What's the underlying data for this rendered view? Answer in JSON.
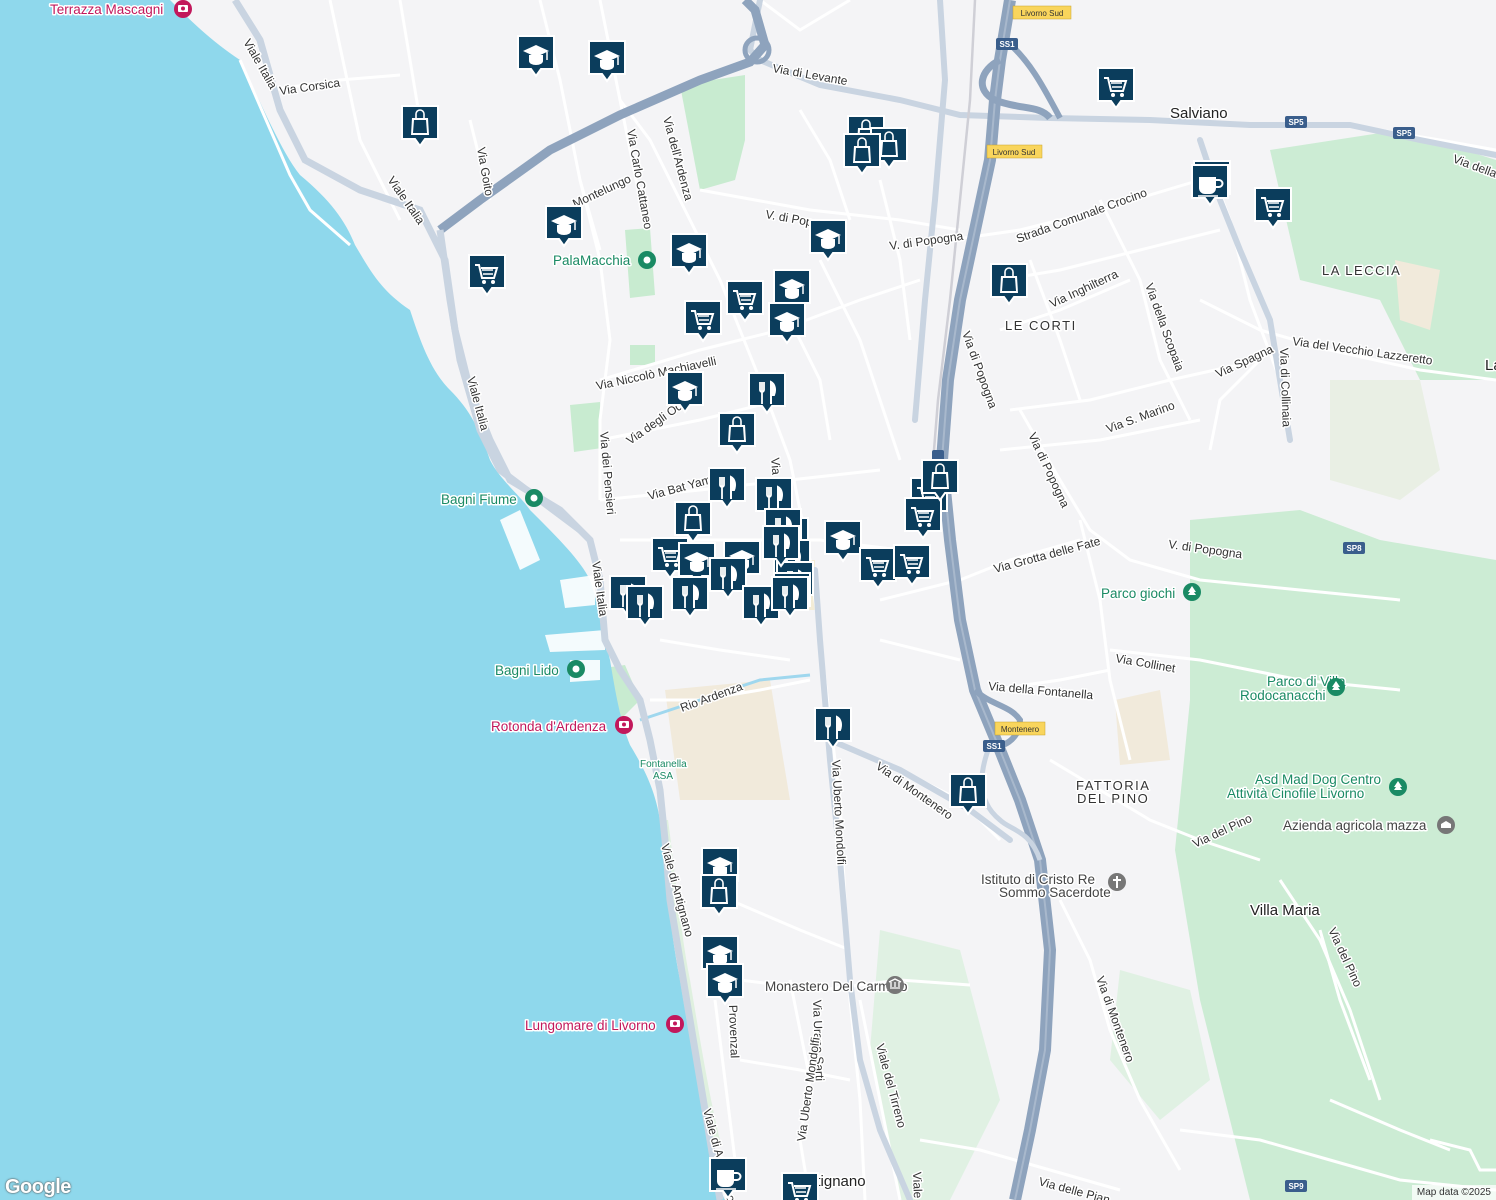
{
  "colors": {
    "sea": "#8fd8ec",
    "land": "#f4f4f6",
    "park": "#c8ebd0",
    "highway": "#8ea3bd",
    "road": "#ffffff",
    "marker": "#0b3d5c",
    "sand": "#f1eadb"
  },
  "street_labels": [
    {
      "text": "Viale Italia",
      "r": 60
    },
    {
      "text": "Via Corsica",
      "r": -8
    },
    {
      "text": "Via Goito",
      "r": 80
    },
    {
      "text": "Viale Italia",
      "r": 55
    },
    {
      "text": "Via di Levante",
      "r": 10
    },
    {
      "text": "Via Carlo Cattaneo",
      "r": 80
    },
    {
      "text": "Via dell'Ardenza",
      "r": 75
    },
    {
      "text": "Montelungo",
      "r": -25
    },
    {
      "text": "V. di Popogna",
      "r": 10
    },
    {
      "text": "V. di Popogna",
      "r": -8
    },
    {
      "text": "Strada Comunale Crocino",
      "r": -20
    },
    {
      "text": "Via Inghilterra",
      "r": -25
    },
    {
      "text": "Via della Scopaia",
      "r": 70
    },
    {
      "text": "Via Spagna",
      "r": -25
    },
    {
      "text": "Via del Vecchio Lazzeretto",
      "r": 8
    },
    {
      "text": "Via di Collinaia",
      "r": 88
    },
    {
      "text": "Via S. Marino",
      "r": -20
    },
    {
      "text": "Via di Popogna",
      "r": 70
    },
    {
      "text": "Via di Popogna",
      "r": 65
    },
    {
      "text": "V. di Popogna",
      "r": 8
    },
    {
      "text": "Via Niccolò Machiavelli",
      "r": -12
    },
    {
      "text": "Via degli Od",
      "r": -35
    },
    {
      "text": "Via dei Pensieri",
      "r": 85
    },
    {
      "text": "Via Bat Yam",
      "r": -15
    },
    {
      "text": "Viale Italia",
      "r": 75
    },
    {
      "text": "Viale Italia",
      "r": 82
    },
    {
      "text": "Rio Ardenza",
      "r": -20
    },
    {
      "text": "Via Grotta delle Fate",
      "r": -15
    },
    {
      "text": "Via Collinet",
      "r": 10
    },
    {
      "text": "Via della Fontanella",
      "r": 5
    },
    {
      "text": "Via di Montenero",
      "r": 35
    },
    {
      "text": "Via Uberto Mondolfi",
      "r": 87
    },
    {
      "text": "Via del Pino",
      "r": -25
    },
    {
      "text": "Viale di Antignano",
      "r": 75
    },
    {
      "text": "Provenzal",
      "r": 88
    },
    {
      "text": "Via Urano Sarti",
      "r": 88
    },
    {
      "text": "Via Uberto Mondolfi",
      "r": -82
    },
    {
      "text": "Viale del Tirreno",
      "r": 75
    },
    {
      "text": "Via di Montenero",
      "r": 70
    },
    {
      "text": "Via del Pino",
      "r": 65
    },
    {
      "text": "Viale di Antignano",
      "r": 75
    },
    {
      "text": "Via delle Pian",
      "r": 15
    },
    {
      "text": "Via della",
      "r": 20
    },
    {
      "text": "Viale",
      "r": 88
    },
    {
      "text": "Via dell'Ardenza",
      "r": 85
    }
  ],
  "area_labels": [
    "Salviano",
    "LE CORTI",
    "LA LECCIA",
    "FATTORIA",
    "DEL PINO",
    "Villa Maria",
    "Antignano",
    "La"
  ],
  "pois": [
    {
      "name": "Terrazza Mascagni",
      "type": "camera"
    },
    {
      "name": "PalaMacchia",
      "type": "park"
    },
    {
      "name": "Bagni Fiume",
      "type": "park"
    },
    {
      "name": "Bagni Lido",
      "type": "park"
    },
    {
      "name": "Rotonda d'Ardenza",
      "type": "camera"
    },
    {
      "name": "Parco giochi",
      "type": "tree"
    },
    {
      "name": "Parco di Villa",
      "type": "tree"
    },
    {
      "name": "Rodocanacchi",
      "type": "tree"
    },
    {
      "name": "Asd Mad Dog Centro",
      "type": "tree"
    },
    {
      "name": "Attività Cinofile Livorno",
      "type": "tree"
    },
    {
      "name": "Azienda agricola mazza",
      "type": "museum"
    },
    {
      "name": "Istituto di Cristo Re",
      "type": "church"
    },
    {
      "name": "Sommo Sacerdote",
      "type": "church"
    },
    {
      "name": "Monastero Del Carmelo",
      "type": "museum"
    },
    {
      "name": "Lungomare di Livorno",
      "type": "camera"
    },
    {
      "name": "Fontanella",
      "type": "text"
    },
    {
      "name": "ASA",
      "type": "text"
    }
  ],
  "road_badges": [
    {
      "text": "Livorno Sud",
      "kind": "yellow"
    },
    {
      "text": "SS1",
      "kind": "shield"
    },
    {
      "text": "Livorno Sud",
      "kind": "yellow"
    },
    {
      "text": "SP5",
      "kind": "shield"
    },
    {
      "text": "SP5",
      "kind": "shield"
    },
    {
      "text": "SS1",
      "kind": "shield"
    },
    {
      "text": "SP8",
      "kind": "shield"
    },
    {
      "text": "Montenero",
      "kind": "yellow"
    },
    {
      "text": "SS1",
      "kind": "shield"
    },
    {
      "text": "SP9",
      "kind": "shield"
    }
  ],
  "markers": [
    {
      "type": "school"
    },
    {
      "type": "school"
    },
    {
      "type": "shop"
    },
    {
      "type": "shop"
    },
    {
      "type": "shop"
    },
    {
      "type": "shop"
    },
    {
      "type": "cart"
    },
    {
      "type": "cafe"
    },
    {
      "type": "cafe"
    },
    {
      "type": "school"
    },
    {
      "type": "school"
    },
    {
      "type": "cart"
    },
    {
      "type": "school"
    },
    {
      "type": "cart"
    },
    {
      "type": "school"
    },
    {
      "type": "cart"
    },
    {
      "type": "school"
    },
    {
      "type": "shop"
    },
    {
      "type": "cart"
    },
    {
      "type": "school"
    },
    {
      "type": "food"
    },
    {
      "type": "shop"
    },
    {
      "type": "food"
    },
    {
      "type": "food"
    },
    {
      "type": "shop"
    },
    {
      "type": "shop"
    },
    {
      "type": "cart"
    },
    {
      "type": "cart"
    },
    {
      "type": "food"
    },
    {
      "type": "shop"
    },
    {
      "type": "school"
    },
    {
      "type": "cart"
    },
    {
      "type": "cart"
    },
    {
      "type": "cart"
    },
    {
      "type": "school"
    },
    {
      "type": "school"
    },
    {
      "type": "food"
    },
    {
      "type": "food"
    },
    {
      "type": "food"
    },
    {
      "type": "food"
    },
    {
      "type": "food"
    },
    {
      "type": "food"
    },
    {
      "type": "food"
    },
    {
      "type": "food"
    },
    {
      "type": "food"
    },
    {
      "type": "food"
    },
    {
      "type": "food"
    },
    {
      "type": "shop"
    },
    {
      "type": "school"
    },
    {
      "type": "shop"
    },
    {
      "type": "school"
    },
    {
      "type": "school"
    },
    {
      "type": "cafe"
    },
    {
      "type": "cart"
    }
  ],
  "google_logo": "Google",
  "attribution": "Map data ©2025"
}
